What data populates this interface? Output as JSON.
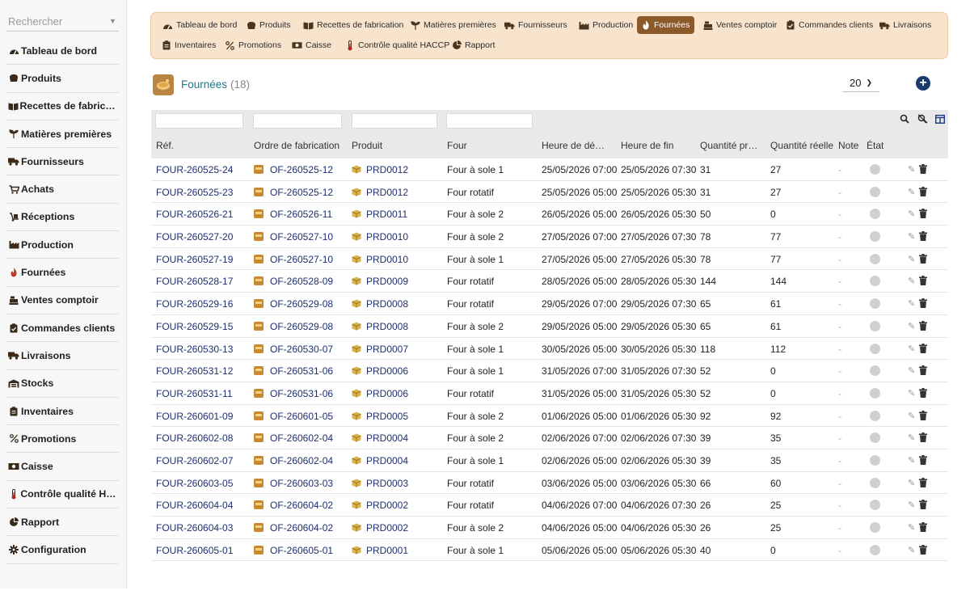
{
  "sidebar": {
    "search_placeholder": "Rechercher",
    "items": [
      {
        "label": "Tableau de bord",
        "icon": "dashboard-icon"
      },
      {
        "label": "Produits",
        "icon": "bread-icon"
      },
      {
        "label": "Recettes de fabrication",
        "icon": "book-icon"
      },
      {
        "label": "Matières premières",
        "icon": "seedling-icon"
      },
      {
        "label": "Fournisseurs",
        "icon": "truck-icon"
      },
      {
        "label": "Achats",
        "icon": "cart-icon"
      },
      {
        "label": "Réceptions",
        "icon": "dolly-icon"
      },
      {
        "label": "Production",
        "icon": "factory-icon"
      },
      {
        "label": "Fournées",
        "icon": "flame-icon"
      },
      {
        "label": "Ventes comptoir",
        "icon": "cash-register-icon"
      },
      {
        "label": "Commandes clients",
        "icon": "clipboard-icon"
      },
      {
        "label": "Livraisons",
        "icon": "delivery-truck-icon"
      },
      {
        "label": "Stocks",
        "icon": "warehouse-icon"
      },
      {
        "label": "Inventaires",
        "icon": "clipboard-list-icon"
      },
      {
        "label": "Promotions",
        "icon": "percent-icon"
      },
      {
        "label": "Caisse",
        "icon": "money-icon"
      },
      {
        "label": "Contrôle qualité HA…",
        "icon": "thermometer-icon"
      },
      {
        "label": "Rapport",
        "icon": "pie-chart-icon"
      },
      {
        "label": "Configuration",
        "icon": "gear-icon"
      }
    ]
  },
  "topnav": {
    "items": [
      {
        "label": "Tableau de bord",
        "icon": "dashboard-icon"
      },
      {
        "label": "Produits",
        "icon": "bread-icon"
      },
      {
        "label": "Recettes de fabrication",
        "icon": "book-icon"
      },
      {
        "label": "Matières premières",
        "icon": "seedling-icon"
      },
      {
        "label": "Fournisseurs",
        "icon": "truck-icon"
      },
      {
        "label": "Production",
        "icon": "factory-icon"
      },
      {
        "label": "Fournées",
        "icon": "flame-icon",
        "active": true
      },
      {
        "label": "Ventes comptoir",
        "icon": "cash-register-icon"
      },
      {
        "label": "Commandes clients",
        "icon": "clipboard-icon"
      },
      {
        "label": "Livraisons",
        "icon": "delivery-truck-icon"
      },
      {
        "label": "Inventaires",
        "icon": "clipboard-list-icon"
      },
      {
        "label": "Promotions",
        "icon": "percent-icon"
      },
      {
        "label": "Caisse",
        "icon": "money-icon"
      },
      {
        "label": "Contrôle qualité HACCP",
        "icon": "thermometer-icon"
      },
      {
        "label": "Rapport",
        "icon": "pie-chart-icon"
      }
    ]
  },
  "page": {
    "title": "Fournées",
    "count": "(18)",
    "per_page": "20",
    "add_icon": "plus-circle-icon"
  },
  "table": {
    "columns": [
      "Réf.",
      "Ordre de fabrication",
      "Produit",
      "Four",
      "Heure de dém…",
      "Heure de fin",
      "Quantité pré…",
      "Quantité réelle",
      "Note",
      "État"
    ],
    "rows": [
      {
        "ref": "FOUR-260525-24",
        "of": "OF-260525-12",
        "produit": "PRD0012",
        "four": "Four à sole 1",
        "debut": "25/05/2026 07:00",
        "fin": "25/05/2026 07:30",
        "qp": "31",
        "qr": "27",
        "note": "-"
      },
      {
        "ref": "FOUR-260525-23",
        "of": "OF-260525-12",
        "produit": "PRD0012",
        "four": "Four rotatif",
        "debut": "25/05/2026 05:00",
        "fin": "25/05/2026 05:30",
        "qp": "31",
        "qr": "27",
        "note": "-"
      },
      {
        "ref": "FOUR-260526-21",
        "of": "OF-260526-11",
        "produit": "PRD0011",
        "four": "Four à sole 2",
        "debut": "26/05/2026 05:00",
        "fin": "26/05/2026 05:30",
        "qp": "50",
        "qr": "0",
        "note": "-"
      },
      {
        "ref": "FOUR-260527-20",
        "of": "OF-260527-10",
        "produit": "PRD0010",
        "four": "Four à sole 2",
        "debut": "27/05/2026 07:00",
        "fin": "27/05/2026 07:30",
        "qp": "78",
        "qr": "77",
        "note": "-"
      },
      {
        "ref": "FOUR-260527-19",
        "of": "OF-260527-10",
        "produit": "PRD0010",
        "four": "Four à sole 1",
        "debut": "27/05/2026 05:00",
        "fin": "27/05/2026 05:30",
        "qp": "78",
        "qr": "77",
        "note": "-"
      },
      {
        "ref": "FOUR-260528-17",
        "of": "OF-260528-09",
        "produit": "PRD0009",
        "four": "Four rotatif",
        "debut": "28/05/2026 05:00",
        "fin": "28/05/2026 05:30",
        "qp": "144",
        "qr": "144",
        "note": "-"
      },
      {
        "ref": "FOUR-260529-16",
        "of": "OF-260529-08",
        "produit": "PRD0008",
        "four": "Four rotatif",
        "debut": "29/05/2026 07:00",
        "fin": "29/05/2026 07:30",
        "qp": "65",
        "qr": "61",
        "note": "-"
      },
      {
        "ref": "FOUR-260529-15",
        "of": "OF-260529-08",
        "produit": "PRD0008",
        "four": "Four à sole 2",
        "debut": "29/05/2026 05:00",
        "fin": "29/05/2026 05:30",
        "qp": "65",
        "qr": "61",
        "note": "-"
      },
      {
        "ref": "FOUR-260530-13",
        "of": "OF-260530-07",
        "produit": "PRD0007",
        "four": "Four à sole 1",
        "debut": "30/05/2026 05:00",
        "fin": "30/05/2026 05:30",
        "qp": "118",
        "qr": "112",
        "note": "-"
      },
      {
        "ref": "FOUR-260531-12",
        "of": "OF-260531-06",
        "produit": "PRD0006",
        "four": "Four à sole 1",
        "debut": "31/05/2026 07:00",
        "fin": "31/05/2026 07:30",
        "qp": "52",
        "qr": "0",
        "note": "-"
      },
      {
        "ref": "FOUR-260531-11",
        "of": "OF-260531-06",
        "produit": "PRD0006",
        "four": "Four rotatif",
        "debut": "31/05/2026 05:00",
        "fin": "31/05/2026 05:30",
        "qp": "52",
        "qr": "0",
        "note": "-"
      },
      {
        "ref": "FOUR-260601-09",
        "of": "OF-260601-05",
        "produit": "PRD0005",
        "four": "Four à sole 2",
        "debut": "01/06/2026 05:00",
        "fin": "01/06/2026 05:30",
        "qp": "92",
        "qr": "92",
        "note": "-"
      },
      {
        "ref": "FOUR-260602-08",
        "of": "OF-260602-04",
        "produit": "PRD0004",
        "four": "Four à sole 2",
        "debut": "02/06/2026 07:00",
        "fin": "02/06/2026 07:30",
        "qp": "39",
        "qr": "35",
        "note": "-"
      },
      {
        "ref": "FOUR-260602-07",
        "of": "OF-260602-04",
        "produit": "PRD0004",
        "four": "Four à sole 1",
        "debut": "02/06/2026 05:00",
        "fin": "02/06/2026 05:30",
        "qp": "39",
        "qr": "35",
        "note": "-"
      },
      {
        "ref": "FOUR-260603-05",
        "of": "OF-260603-03",
        "produit": "PRD0003",
        "four": "Four rotatif",
        "debut": "03/06/2026 05:00",
        "fin": "03/06/2026 05:30",
        "qp": "66",
        "qr": "60",
        "note": "-"
      },
      {
        "ref": "FOUR-260604-04",
        "of": "OF-260604-02",
        "produit": "PRD0002",
        "four": "Four rotatif",
        "debut": "04/06/2026 07:00",
        "fin": "04/06/2026 07:30",
        "qp": "26",
        "qr": "25",
        "note": "-"
      },
      {
        "ref": "FOUR-260604-03",
        "of": "OF-260604-02",
        "produit": "PRD0002",
        "four": "Four à sole 2",
        "debut": "04/06/2026 05:00",
        "fin": "04/06/2026 05:30",
        "qp": "26",
        "qr": "25",
        "note": "-"
      },
      {
        "ref": "FOUR-260605-01",
        "of": "OF-260605-01",
        "produit": "PRD0001",
        "four": "Four à sole 1",
        "debut": "05/06/2026 05:00",
        "fin": "05/06/2026 05:30",
        "qp": "40",
        "qr": "0",
        "note": "-"
      }
    ]
  },
  "colors": {
    "nav_bg": "#f8e4cd",
    "nav_active": "#8b5a2b",
    "link": "#1e2f6f",
    "title": "#1a7a8a",
    "add_button": "#1a3a6e"
  }
}
